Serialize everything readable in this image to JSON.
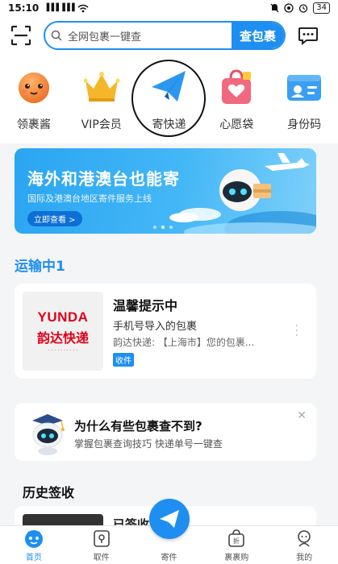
{
  "status_bar": {
    "time": "15:10",
    "signal": "▐▐▐ ▐▐▐",
    "battery": "34"
  },
  "search": {
    "placeholder": "全网包裹一键查",
    "button_label": "查包裹"
  },
  "quick_menu": [
    {
      "label": "领裹酱",
      "icon": "mascot-face-icon"
    },
    {
      "label": "VIP会员",
      "icon": "crown-icon"
    },
    {
      "label": "寄快递",
      "icon": "paper-plane-icon"
    },
    {
      "label": "心愿袋",
      "icon": "heart-bag-icon"
    },
    {
      "label": "身份码",
      "icon": "id-card-icon"
    }
  ],
  "banner": {
    "title": "海外和港澳台也能寄",
    "subtitle": "国际及港澳台地区寄件服务上线",
    "cta": "立即查看 >"
  },
  "transit": {
    "title": "运输中1"
  },
  "package": {
    "logo_en": "YUNDA",
    "logo_cn": "韵达快递",
    "name": "温馨提示中",
    "subtitle": "手机号导入的包裹",
    "description": "韵达快递: 【上海市】您的包裹...",
    "tag": "收件"
  },
  "tip": {
    "question": "为什么有些包裹查不到?",
    "detail": "掌握包裹查询技巧 快递单号一键查"
  },
  "history": {
    "title": "历史签收",
    "item_label": "已签收"
  },
  "tab_bar": [
    {
      "label": "首页",
      "icon": "home-mascot-icon",
      "active": true
    },
    {
      "label": "取件",
      "icon": "pickup-icon"
    },
    {
      "label": "寄件",
      "icon": "send-plane-icon"
    },
    {
      "label": "裹裹购",
      "icon": "shopping-bag-icon"
    },
    {
      "label": "我的",
      "icon": "profile-icon"
    }
  ],
  "colors": {
    "accent": "#1e8ff0",
    "yunda_red": "#e0001a"
  }
}
